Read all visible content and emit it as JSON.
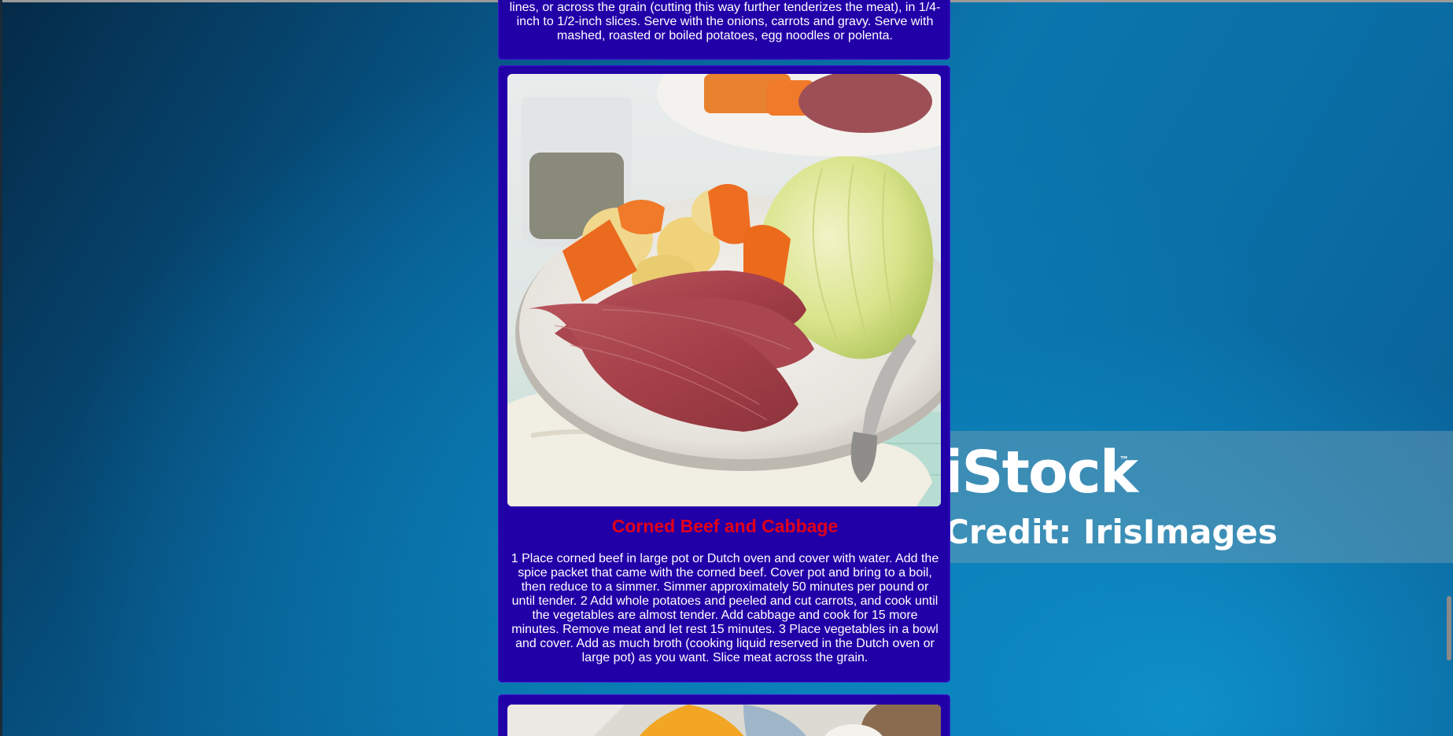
{
  "previous_recipe": {
    "instructions_tail": "lines, or across the grain (cutting this way further tenderizes the meat), in 1/4-inch to 1/2-inch slices. Serve with the onions, carrots and gravy. Serve with mashed, roasted or boiled potatoes, egg noodles or polenta."
  },
  "recipe": {
    "photo_alt": "corned-beef-cabbage-photo",
    "title": "Corned Beef and Cabbage",
    "instructions": "1 Place corned beef in large pot or Dutch oven and cover with water. Add the spice packet that came with the corned beef. Cover pot and bring to a boil, then reduce to a simmer. Simmer approximately 50 minutes per pound or until tender. 2 Add whole potatoes and peeled and cut carrots, and cook until the vegetables are almost tender. Add cabbage and cook for 15 more minutes. Remove meat and let rest 15 minutes. 3 Place vegetables in a bowl and cover. Add as much broth (cooking liquid reserved in the Dutch oven or large pot) as you want. Slice meat across the grain."
  },
  "watermark": {
    "brand": "iStock",
    "trademark": "™",
    "credit": "Credit: IrisImages"
  },
  "colors": {
    "card_background": "#2200a8",
    "title": "#e0001a",
    "text": "#ffffff"
  }
}
